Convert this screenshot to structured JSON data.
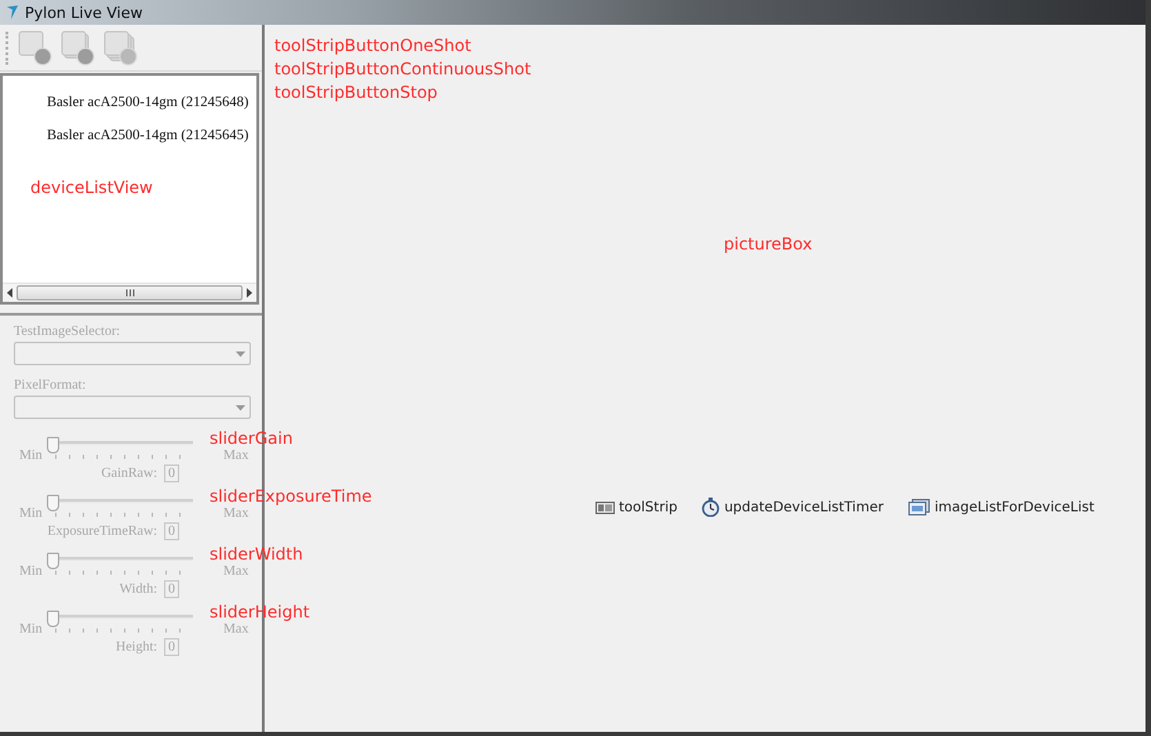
{
  "window": {
    "title": "Pylon Live View"
  },
  "toolbar": {
    "buttons": [
      {
        "kind": "one-shot",
        "disabled": true
      },
      {
        "kind": "continuous",
        "disabled": true
      },
      {
        "kind": "stop",
        "disabled": true
      }
    ]
  },
  "device_list": {
    "items": [
      "Basler acA2500-14gm (21245648)",
      "Basler acA2500-14gm (21245645)"
    ],
    "annotation": "deviceListView"
  },
  "selectors": [
    {
      "label": "TestImageSelector:",
      "disabled": true
    },
    {
      "label": "PixelFormat:",
      "disabled": true
    }
  ],
  "sliders": [
    {
      "min": "Min",
      "max": "Max",
      "label": "GainRaw:",
      "value": "0",
      "level": 0,
      "disabled": true,
      "annotation": "sliderGain"
    },
    {
      "min": "Min",
      "max": "Max",
      "label": "ExposureTimeRaw:",
      "value": "0",
      "level": 0,
      "disabled": true,
      "annotation": "sliderExposureTime"
    },
    {
      "min": "Min",
      "max": "Max",
      "label": "Width:",
      "value": "0",
      "level": 0,
      "disabled": true,
      "annotation": "sliderWidth"
    },
    {
      "min": "Min",
      "max": "Max",
      "label": "Height:",
      "value": "0",
      "level": 0,
      "disabled": true,
      "annotation": "sliderHeight"
    }
  ],
  "picture_box": {
    "annotations": [
      "toolStripButtonOneShot",
      "toolStripButtonContinuousShot",
      "toolStripButtonStop"
    ],
    "label": "pictureBox"
  },
  "component_tray": [
    {
      "kind": "toolstrip",
      "text": "toolStrip"
    },
    {
      "kind": "timer",
      "text": "updateDeviceListTimer"
    },
    {
      "kind": "imagelist",
      "text": "imageListForDeviceList"
    }
  ]
}
